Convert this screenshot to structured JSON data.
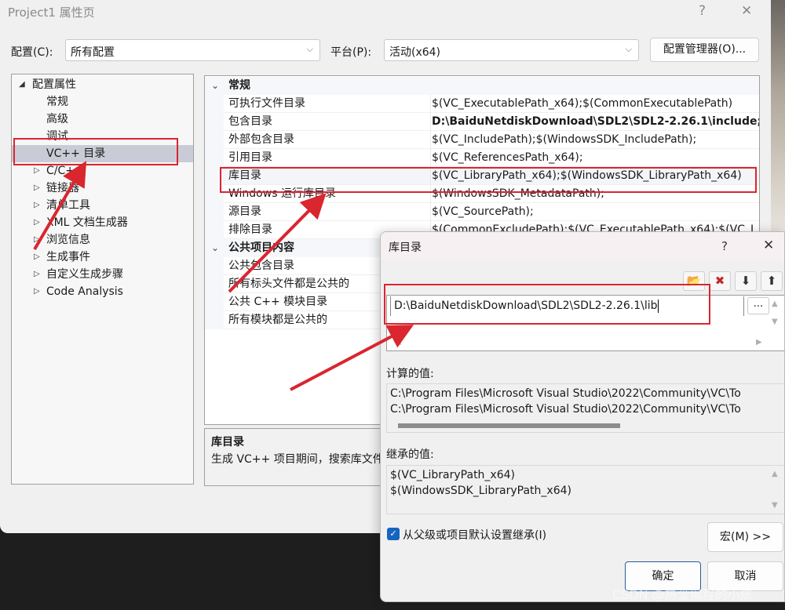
{
  "main_window": {
    "title": "Project1 属性页",
    "help_glyph": "?",
    "close_glyph": "✕",
    "config_label": "配置(C):",
    "config_value": "所有配置",
    "platform_label": "平台(P):",
    "platform_value": "活动(x64)",
    "config_manager_button": "配置管理器(O)...",
    "chevron_glyph": "⌵"
  },
  "tree": {
    "root": {
      "label": "配置属性",
      "arrow": "◢"
    },
    "children": [
      {
        "label": "常规"
      },
      {
        "label": "高级"
      },
      {
        "label": "调试"
      },
      {
        "label": "VC++ 目录",
        "selected": true
      }
    ],
    "collapsed": [
      {
        "label": "C/C++",
        "arrow": "▷"
      },
      {
        "label": "链接器",
        "arrow": "▷"
      },
      {
        "label": "清单工具",
        "arrow": "▷"
      },
      {
        "label": "XML 文档生成器",
        "arrow": "▷"
      },
      {
        "label": "浏览信息",
        "arrow": "▷"
      },
      {
        "label": "生成事件",
        "arrow": "▷"
      },
      {
        "label": "自定义生成步骤",
        "arrow": "▷"
      },
      {
        "label": "Code Analysis",
        "arrow": "▷"
      }
    ]
  },
  "grid": {
    "expand_glyph": "⌄",
    "categories": [
      {
        "name": "常规",
        "properties": [
          {
            "name": "可执行文件目录",
            "value": "$(VC_ExecutablePath_x64);$(CommonExecutablePath)"
          },
          {
            "name": "包含目录",
            "value": "D:\\BaiduNetdiskDownload\\SDL2\\SDL2-2.26.1\\include;$",
            "bold": true
          },
          {
            "name": "外部包含目录",
            "value": "$(VC_IncludePath);$(WindowsSDK_IncludePath);"
          },
          {
            "name": "引用目录",
            "value": "$(VC_ReferencesPath_x64);"
          },
          {
            "name": "库目录",
            "value": "$(VC_LibraryPath_x64);$(WindowsSDK_LibraryPath_x64)"
          },
          {
            "name": "Windows 运行库目录",
            "value": "$(WindowsSDK_MetadataPath);"
          },
          {
            "name": "源目录",
            "value": "$(VC_SourcePath);"
          },
          {
            "name": "排除目录",
            "value": "$(CommonExcludePath);$(VC_ExecutablePath_x64);$(VC_L"
          }
        ]
      },
      {
        "name": "公共项目内容",
        "properties": [
          {
            "name": "公共包含目录",
            "value": ""
          },
          {
            "name": "所有标头文件都是公共的",
            "value": ""
          },
          {
            "name": "公共 C++ 模块目录",
            "value": ""
          },
          {
            "name": "所有模块都是公共的",
            "value": ""
          }
        ]
      }
    ]
  },
  "description": {
    "title": "库目录",
    "text": "生成 VC++ 项目期间，搜索库文件时使用的路径"
  },
  "dialog": {
    "title": "库目录",
    "help_glyph": "?",
    "close_glyph": "✕",
    "toolbar": {
      "new_line_glyph": "📂",
      "delete_glyph": "✖",
      "move_down_glyph": "⬇",
      "move_up_glyph": "⬆"
    },
    "edit_value": "D:\\BaiduNetdiskDownload\\SDL2\\SDL2-2.26.1\\lib",
    "browse_label": "...",
    "scroll_up": "▲",
    "scroll_down": "▼",
    "scroll_left": "◀",
    "scroll_right": "▶",
    "computed_label": "计算的值:",
    "computed_values": [
      "C:\\Program Files\\Microsoft Visual Studio\\2022\\Community\\VC\\To",
      "C:\\Program Files\\Microsoft Visual Studio\\2022\\Community\\VC\\To"
    ],
    "inherited_label": "继承的值:",
    "inherited_values": [
      "$(VC_LibraryPath_x64)",
      "$(WindowsSDK_LibraryPath_x64)"
    ],
    "inherit_checkbox_label": "从父级或项目默认设置继承(I)",
    "inherit_checked": true,
    "check_glyph": "✓",
    "macros_button": "宏(M) >>",
    "ok_button": "确定",
    "cancel_button": "取消"
  },
  "watermark": "CSDN @热爱编程的小陈",
  "colors": {
    "annotation_red": "#d9262f",
    "checkbox_blue": "#1565c0",
    "selection": "#c9ccd6"
  }
}
